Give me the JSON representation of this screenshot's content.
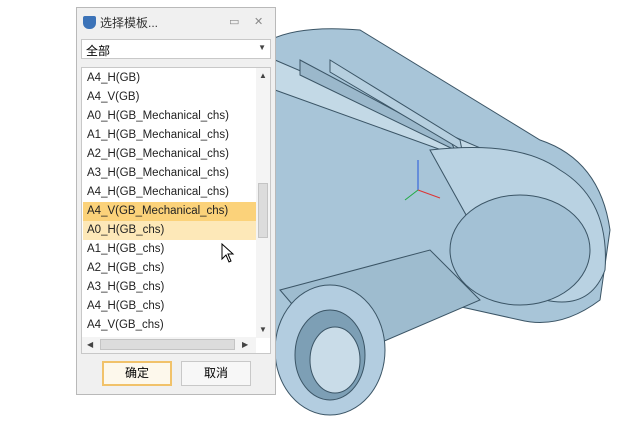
{
  "dialog": {
    "title": "选择模板...",
    "filter": "全部",
    "items": [
      "A4_H(GB)",
      "A4_V(GB)",
      "A0_H(GB_Mechanical_chs)",
      "A1_H(GB_Mechanical_chs)",
      "A2_H(GB_Mechanical_chs)",
      "A3_H(GB_Mechanical_chs)",
      "A4_H(GB_Mechanical_chs)",
      "A4_V(GB_Mechanical_chs)",
      "A0_H(GB_chs)",
      "A1_H(GB_chs)",
      "A2_H(GB_chs)",
      "A3_H(GB_chs)",
      "A4_H(GB_chs)",
      "A4_V(GB_chs)"
    ],
    "selected": "A4_V(GB_Mechanical_chs)",
    "hovered": "A0_H(GB_chs)",
    "ok": "确定",
    "cancel": "取消"
  },
  "colors": {
    "model": "#a8c5d8",
    "selection": "#fbd27a"
  }
}
